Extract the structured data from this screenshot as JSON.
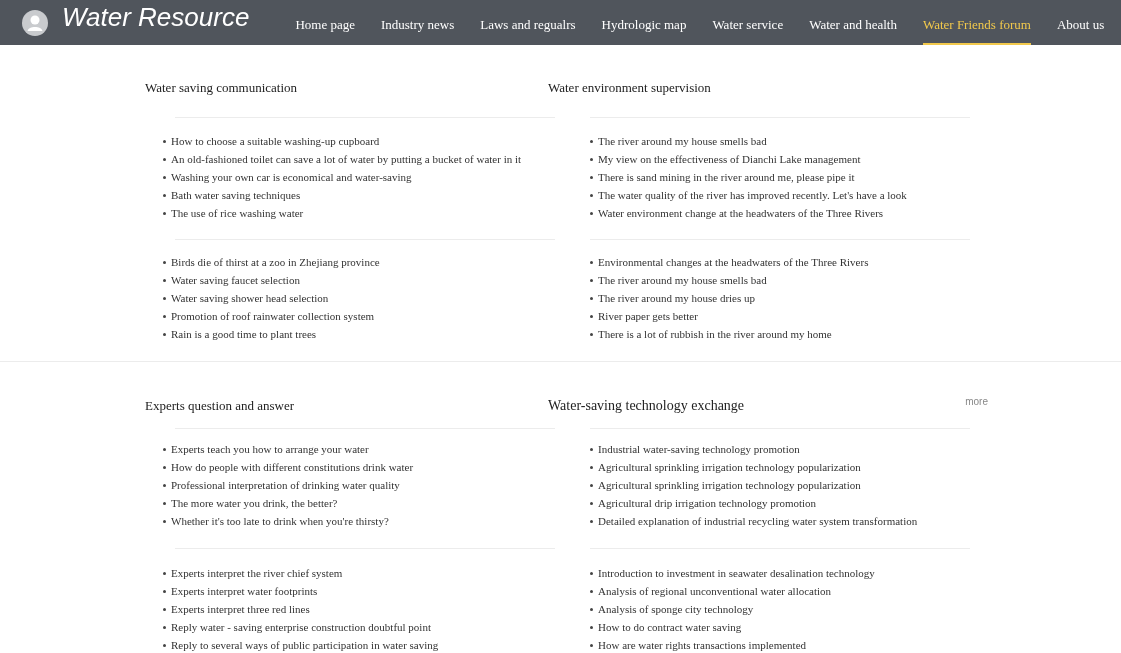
{
  "header": {
    "title": "Water Resource",
    "nav": [
      {
        "label": "Home page",
        "selected": false
      },
      {
        "label": "Industry news",
        "selected": false
      },
      {
        "label": "Laws and regualrs",
        "selected": false
      },
      {
        "label": "Hydrologic map",
        "selected": false
      },
      {
        "label": "Water service",
        "selected": false
      },
      {
        "label": "Water and health",
        "selected": false
      },
      {
        "label": "Water Friends forum",
        "selected": true
      },
      {
        "label": "About us",
        "selected": false
      }
    ]
  },
  "rows": [
    {
      "sections": [
        {
          "title": "Water saving communication",
          "groups": [
            [
              "How to choose a suitable washing-up cupboard",
              "An old-fashioned toilet can save a lot of water by putting a bucket of water in it",
              "Washing your own car is economical and water-saving",
              "Bath water saving techniques",
              "The use of rice washing water"
            ],
            [
              "Birds die of thirst at a zoo in Zhejiang province",
              "Water saving faucet selection",
              "Water saving shower head selection",
              "Promotion of roof rainwater collection system",
              "Rain is a good time to plant trees"
            ]
          ]
        },
        {
          "title": "Water environment supervision",
          "groups": [
            [
              "The river around my house smells bad",
              "My view on the effectiveness of Dianchi Lake management",
              "There is sand mining in the river around me, please pipe it",
              "The water quality of the river has improved recently. Let's have a look",
              "Water environment change at the headwaters of the Three Rivers"
            ],
            [
              "Environmental changes at the headwaters of the Three Rivers",
              "The river around my house smells bad",
              "The river around my house dries up",
              "River paper gets better",
              "There is a lot of rubbish in the river around my home"
            ]
          ]
        }
      ]
    },
    {
      "sections": [
        {
          "title": "Experts question and answer",
          "groups": [
            [
              "Experts teach you how to arrange your water",
              "How do people with different constitutions drink water",
              "Professional interpretation of drinking water quality",
              "The more water you drink, the better?",
              "Whether it's too late to drink when you're thirsty?"
            ],
            [
              "Experts interpret the river chief system",
              "Experts interpret water footprints",
              "Experts interpret three red lines",
              "Reply water - saving enterprise construction doubtful point",
              "Reply to several ways of public participation in water saving"
            ]
          ]
        },
        {
          "title": "Water-saving technology exchange",
          "more": "more",
          "groups": [
            [
              "Industrial water-saving technology promotion",
              "Agricultural sprinkling irrigation technology popularization",
              "Agricultural sprinkling irrigation technology popularization",
              "Agricultural drip irrigation technology promotion",
              "Detailed explanation of industrial recycling water system transformation"
            ],
            [
              "Introduction to investment in seawater desalination technology",
              "Analysis of regional unconventional water allocation",
              "Analysis of sponge city technology",
              "How to do contract water saving",
              "How are water rights transactions implemented"
            ]
          ]
        }
      ]
    }
  ]
}
